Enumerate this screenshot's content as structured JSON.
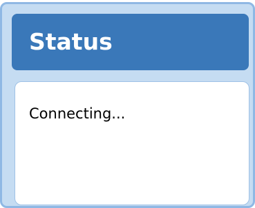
{
  "status_panel": {
    "title": "Status",
    "message": "Connecting..."
  },
  "colors": {
    "panel_background": "#c5dcf2",
    "panel_border": "#8fb8e4",
    "header_background": "#3a78b9",
    "header_text": "#ffffff",
    "content_background": "#ffffff",
    "content_border": "#9ec1e6",
    "message_text": "#000000"
  }
}
